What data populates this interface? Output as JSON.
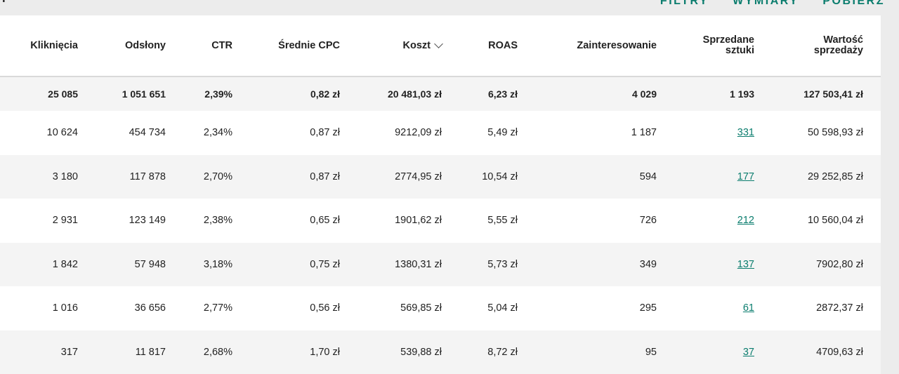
{
  "toolbar": {
    "tab_fragment": "Y",
    "actions": [
      "FILTRY",
      "WYMIARY",
      "POBIERZ"
    ]
  },
  "colors": {
    "accent": "#0b7d6e",
    "row_alt": "#f4f4f4",
    "background": "#ececec"
  },
  "table": {
    "sort_icon": "chevron-down-icon",
    "sorted_column": "Koszt",
    "columns": [
      "Kliknięcia",
      "Odsłony",
      "CTR",
      "Średnie CPC",
      "Koszt",
      "ROAS",
      "Zainteresowanie",
      "Sprzedane sztuki",
      "Wartość sprzedaży"
    ],
    "header_lines": {
      "sprzedane_1": "Sprzedane",
      "sprzedane_2": "sztuki",
      "wartosc_1": "Wartość",
      "wartosc_2": "sprzedaży"
    },
    "totals": [
      "25 085",
      "1 051 651",
      "2,39%",
      "0,82 zł",
      "20 481,03 zł",
      "6,23 zł",
      "4 029",
      "1 193",
      "127 503,41 zł"
    ],
    "rows": [
      [
        "10 624",
        "454 734",
        "2,34%",
        "0,87 zł",
        "9212,09 zł",
        "5,49 zł",
        "1 187",
        "331",
        "50 598,93 zł"
      ],
      [
        "3 180",
        "117 878",
        "2,70%",
        "0,87 zł",
        "2774,95 zł",
        "10,54 zł",
        "594",
        "177",
        "29 252,85 zł"
      ],
      [
        "2 931",
        "123 149",
        "2,38%",
        "0,65 zł",
        "1901,62 zł",
        "5,55 zł",
        "726",
        "212",
        "10 560,04 zł"
      ],
      [
        "1 842",
        "57 948",
        "3,18%",
        "0,75 zł",
        "1380,31 zł",
        "5,73 zł",
        "349",
        "137",
        "7902,80 zł"
      ],
      [
        "1 016",
        "36 656",
        "2,77%",
        "0,56 zł",
        "569,85 zł",
        "5,04 zł",
        "295",
        "61",
        "2872,37 zł"
      ],
      [
        "317",
        "11 817",
        "2,68%",
        "1,70 zł",
        "539,88 zł",
        "8,72 zł",
        "95",
        "37",
        "4709,63 zł"
      ]
    ]
  }
}
